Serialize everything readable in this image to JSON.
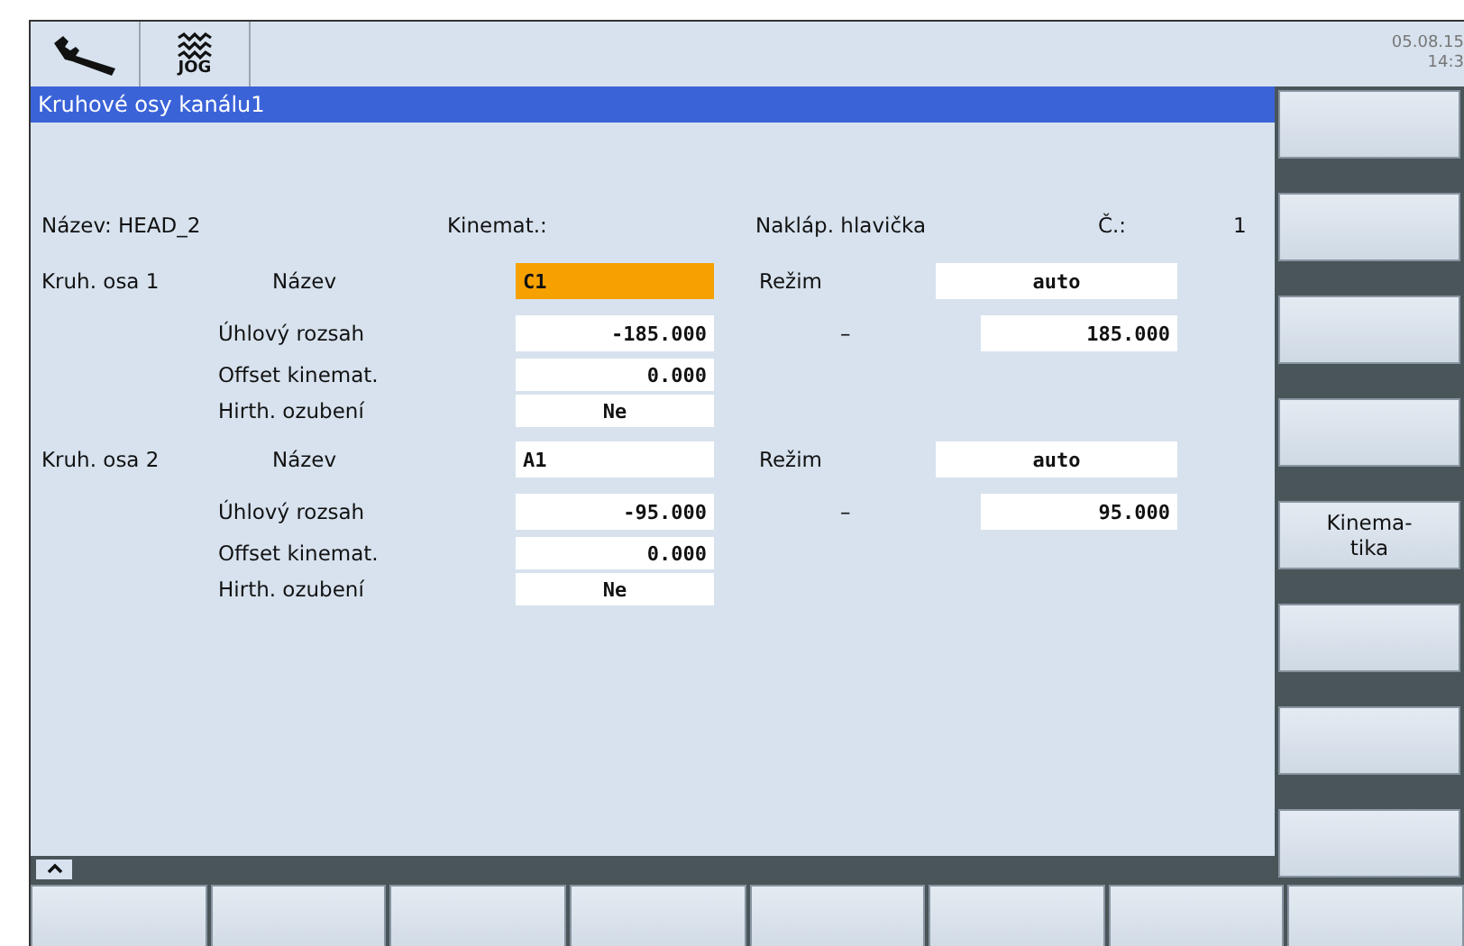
{
  "header": {
    "mode": "JOG",
    "date": "05.08.15",
    "time": "14:3"
  },
  "window": {
    "title": "Kruhové osy kanálu1"
  },
  "kinematics": {
    "name": "Název: HEAD_2",
    "type_label": "Kinemat.:",
    "type_value": "Nakláp. hlavička",
    "number_label": "Č.:",
    "number_value": "1"
  },
  "axes": [
    {
      "label": "Kruh. osa 1",
      "name_label": "Název",
      "name": {
        "value": "C1",
        "focused": true
      },
      "mode_label": "Režim",
      "mode": {
        "value": "auto",
        "focused": false
      },
      "range_label": "Úhlový rozsah",
      "range_min": {
        "value": "-185.000",
        "focused": false
      },
      "range_separator": "–",
      "range_max": {
        "value": "185.000",
        "focused": false
      },
      "offset_label": "Offset kinemat.",
      "offset": {
        "value": "0.000",
        "focused": false
      },
      "hirth_label": "Hirth. ozubení",
      "hirth": {
        "value": "Ne",
        "focused": false
      }
    },
    {
      "label": "Kruh. osa 2",
      "name_label": "Název",
      "name": {
        "value": "A1",
        "focused": false
      },
      "mode_label": "Režim",
      "mode": {
        "value": "auto",
        "focused": false
      },
      "range_label": "Úhlový rozsah",
      "range_min": {
        "value": "-95.000",
        "focused": false
      },
      "range_separator": "–",
      "range_max": {
        "value": "95.000",
        "focused": false
      },
      "offset_label": "Offset kinemat.",
      "offset": {
        "value": "0.000",
        "focused": false
      },
      "hirth_label": "Hirth. ozubení",
      "hirth": {
        "value": "Ne",
        "focused": false
      }
    }
  ],
  "vertical_softkeys": [
    {
      "kind": "blank"
    },
    {
      "kind": "blank"
    },
    {
      "kind": "blank"
    },
    {
      "kind": "blank"
    },
    {
      "kind": "text",
      "lines": [
        "Kinema-",
        "tika"
      ]
    },
    {
      "kind": "blank"
    },
    {
      "kind": "blank"
    },
    {
      "kind": "blank"
    }
  ],
  "horizontal_softkeys": [
    {
      "kind": "blank"
    },
    {
      "kind": "blank"
    },
    {
      "kind": "blank"
    },
    {
      "kind": "blank"
    },
    {
      "kind": "blank"
    },
    {
      "kind": "blank"
    },
    {
      "kind": "blank"
    },
    {
      "kind": "blank"
    }
  ]
}
